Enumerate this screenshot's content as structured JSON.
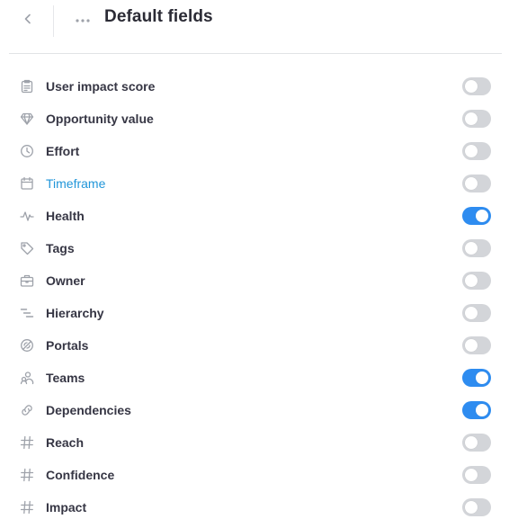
{
  "header": {
    "back_icon": "chevron-left-icon",
    "more_icon": "more-horizontal-icon",
    "title": "Default fields"
  },
  "colors": {
    "toggle_on": "#2e8cf0",
    "toggle_off": "#d3d5d9",
    "link": "#2196d9",
    "icon": "#9ea2aa"
  },
  "fields": [
    {
      "label": "User impact score",
      "icon": "clipboard-icon",
      "on": false
    },
    {
      "label": "Opportunity value",
      "icon": "diamond-icon",
      "on": false
    },
    {
      "label": "Effort",
      "icon": "clock-icon",
      "on": false
    },
    {
      "label": "Timeframe",
      "icon": "calendar-icon",
      "on": false,
      "link": true
    },
    {
      "label": "Health",
      "icon": "pulse-icon",
      "on": true
    },
    {
      "label": "Tags",
      "icon": "tag-icon",
      "on": false
    },
    {
      "label": "Owner",
      "icon": "briefcase-icon",
      "on": false
    },
    {
      "label": "Hierarchy",
      "icon": "hierarchy-icon",
      "on": false
    },
    {
      "label": "Portals",
      "icon": "portal-icon",
      "on": false
    },
    {
      "label": "Teams",
      "icon": "teams-icon",
      "on": true
    },
    {
      "label": "Dependencies",
      "icon": "link-icon",
      "on": true
    },
    {
      "label": "Reach",
      "icon": "hash-icon",
      "on": false
    },
    {
      "label": "Confidence",
      "icon": "hash-icon",
      "on": false
    },
    {
      "label": "Impact",
      "icon": "hash-icon",
      "on": false
    }
  ]
}
